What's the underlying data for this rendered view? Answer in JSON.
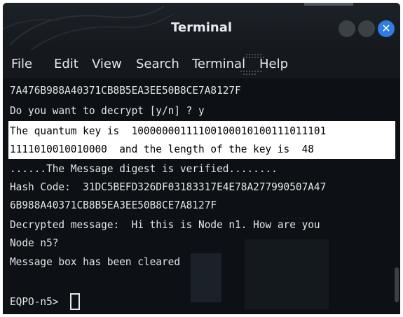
{
  "window": {
    "title": "Terminal",
    "close_glyph": "✕",
    "controls": [
      "minimize-icon",
      "maximize-icon",
      "close-icon"
    ]
  },
  "menu": {
    "items": [
      "File",
      "Edit",
      "View",
      "Search",
      "Terminal",
      "Help"
    ]
  },
  "terminal": {
    "lines": [
      "7A476B988A40371CB8B5EA3EE50B8CE7A8127F",
      "Do you want to decrypt [y/n] ? y",
      "The quantum key is  1000000011110010001010011101110​1",
      "1111010010010000  and the length of the key is  48",
      "......The Message digest is verified........",
      "Hash Code:  31DC5BEFD326DF03183317E4E78A277990507A47",
      "6B988A40371CB8B5EA3EE50B8CE7A8127F",
      "Decrypted message:  Hi this is Node n1. How are you",
      "Node n5?",
      "Message box has been cleared",
      "",
      "EQPO-n5> "
    ]
  },
  "colors": {
    "background": "#0d1115",
    "text": "#e4e6e8",
    "highlight": "#ffffff",
    "close_button": "#2f7de1"
  }
}
